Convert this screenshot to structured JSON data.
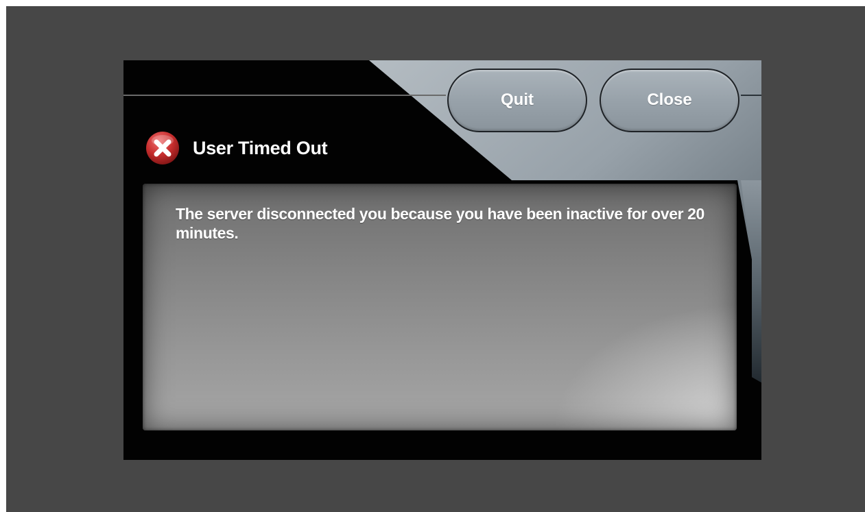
{
  "dialog": {
    "title": "User Timed Out",
    "icon": "error-x-icon",
    "message": "The server disconnected you because you have been inactive for over 20 minutes.",
    "buttons": {
      "quit_label": "Quit",
      "close_label": "Close"
    }
  },
  "colors": {
    "backdrop": "#474747",
    "dialog_background": "#020202",
    "chrome_steel": "#9ea7ae",
    "error_red": "#c62d2d",
    "text": "#ffffff"
  }
}
